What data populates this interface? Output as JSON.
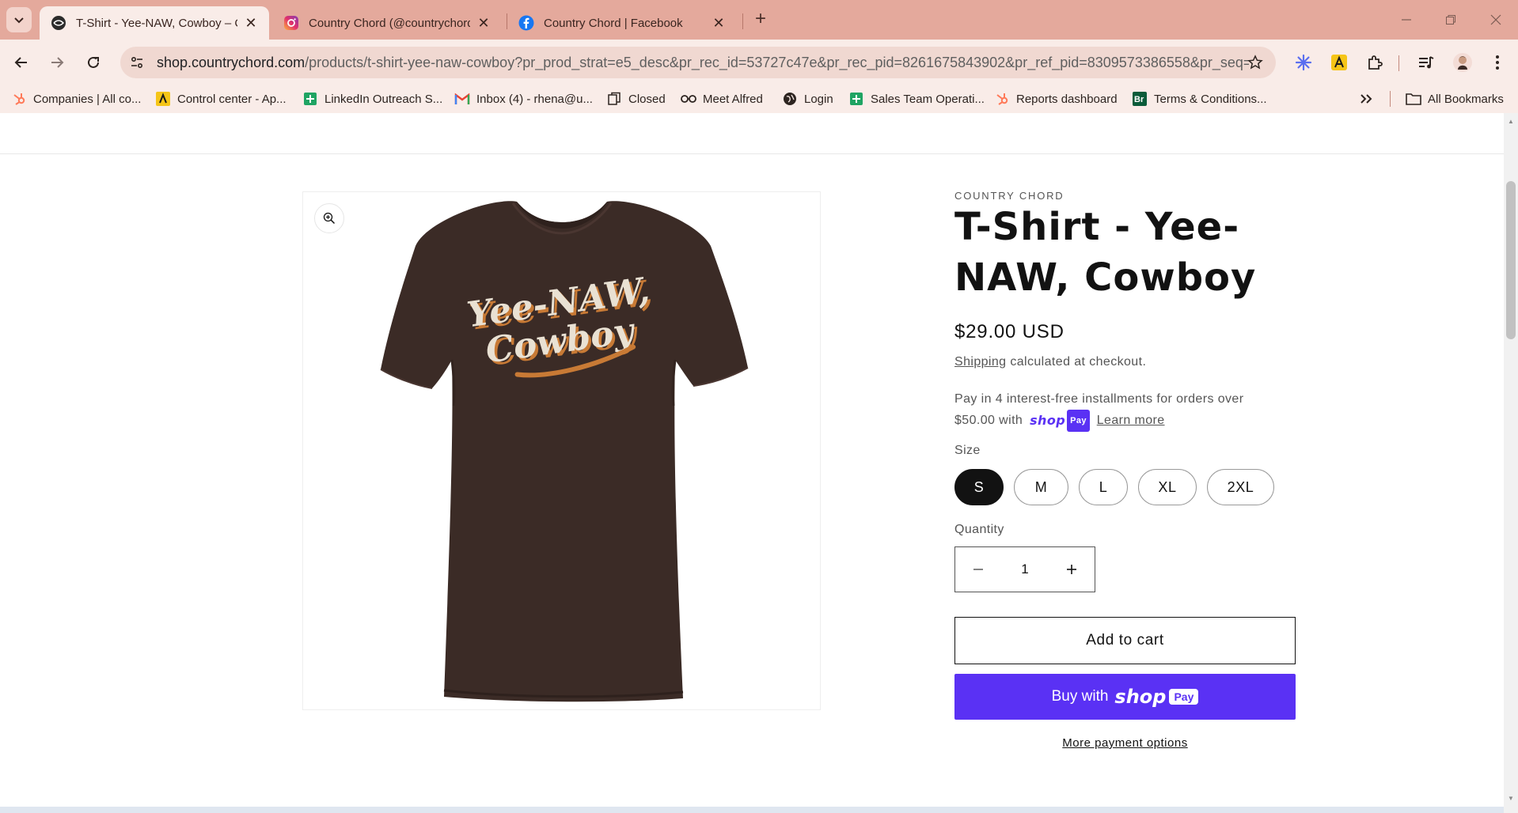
{
  "browser": {
    "tabs": [
      {
        "title": "T-Shirt - Yee-NAW, Cowboy – C",
        "active": true,
        "icon": "countrychord-favicon"
      },
      {
        "title": "Country Chord (@countrychord",
        "active": false,
        "icon": "instagram-icon"
      },
      {
        "title": "Country Chord | Facebook",
        "active": false,
        "icon": "facebook-icon"
      }
    ],
    "url_domain": "shop.countrychord.com",
    "url_path": "/products/t-shirt-yee-naw-cowboy?pr_prod_strat=e5_desc&pr_rec_id=53727c47e&pr_rec_pid=8261675843902&pr_ref_pid=8309573386558&pr_seq=u...",
    "bookmarks": [
      {
        "label": "Companies | All co...",
        "icon": "hubspot-icon"
      },
      {
        "label": "Control center - Ap...",
        "icon": "apollo-icon"
      },
      {
        "label": "LinkedIn Outreach S...",
        "icon": "sheets-icon"
      },
      {
        "label": "Inbox (4) - rhena@u...",
        "icon": "gmail-icon"
      },
      {
        "label": "Closed",
        "icon": "copy-icon"
      },
      {
        "label": "Meet Alfred",
        "icon": "alfred-icon"
      },
      {
        "label": "Login",
        "icon": "globe-icon"
      },
      {
        "label": "Sales Team Operati...",
        "icon": "sheets-icon"
      },
      {
        "label": "Reports dashboard",
        "icon": "hubspot-icon"
      },
      {
        "label": "Terms & Conditions...",
        "icon": "br-icon"
      }
    ],
    "all_bookmarks": "All Bookmarks"
  },
  "product": {
    "vendor": "COUNTRY CHORD",
    "title": "T-Shirt - Yee-NAW, Cowboy",
    "price": "$29.00 USD",
    "shipping_link": "Shipping",
    "shipping_text": " calculated at checkout.",
    "installments_text": "Pay in 4 interest-free installments for orders over $50.00 with",
    "shop_word": "shop",
    "pay_word": "Pay",
    "learn_more": "Learn more",
    "size_label": "Size",
    "sizes": [
      "S",
      "M",
      "L",
      "XL",
      "2XL"
    ],
    "selected_size": "S",
    "quantity_label": "Quantity",
    "quantity": "1",
    "add_to_cart": "Add to cart",
    "buy_with": "Buy with",
    "more_payment": "More payment options",
    "shirt_text_line1": "Yee-NAW,",
    "shirt_text_line2": "Cowboy"
  },
  "colors": {
    "chrome_accent": "#e4a99c",
    "shop_pay": "#5a31f4",
    "shirt": "#3b2b26"
  }
}
